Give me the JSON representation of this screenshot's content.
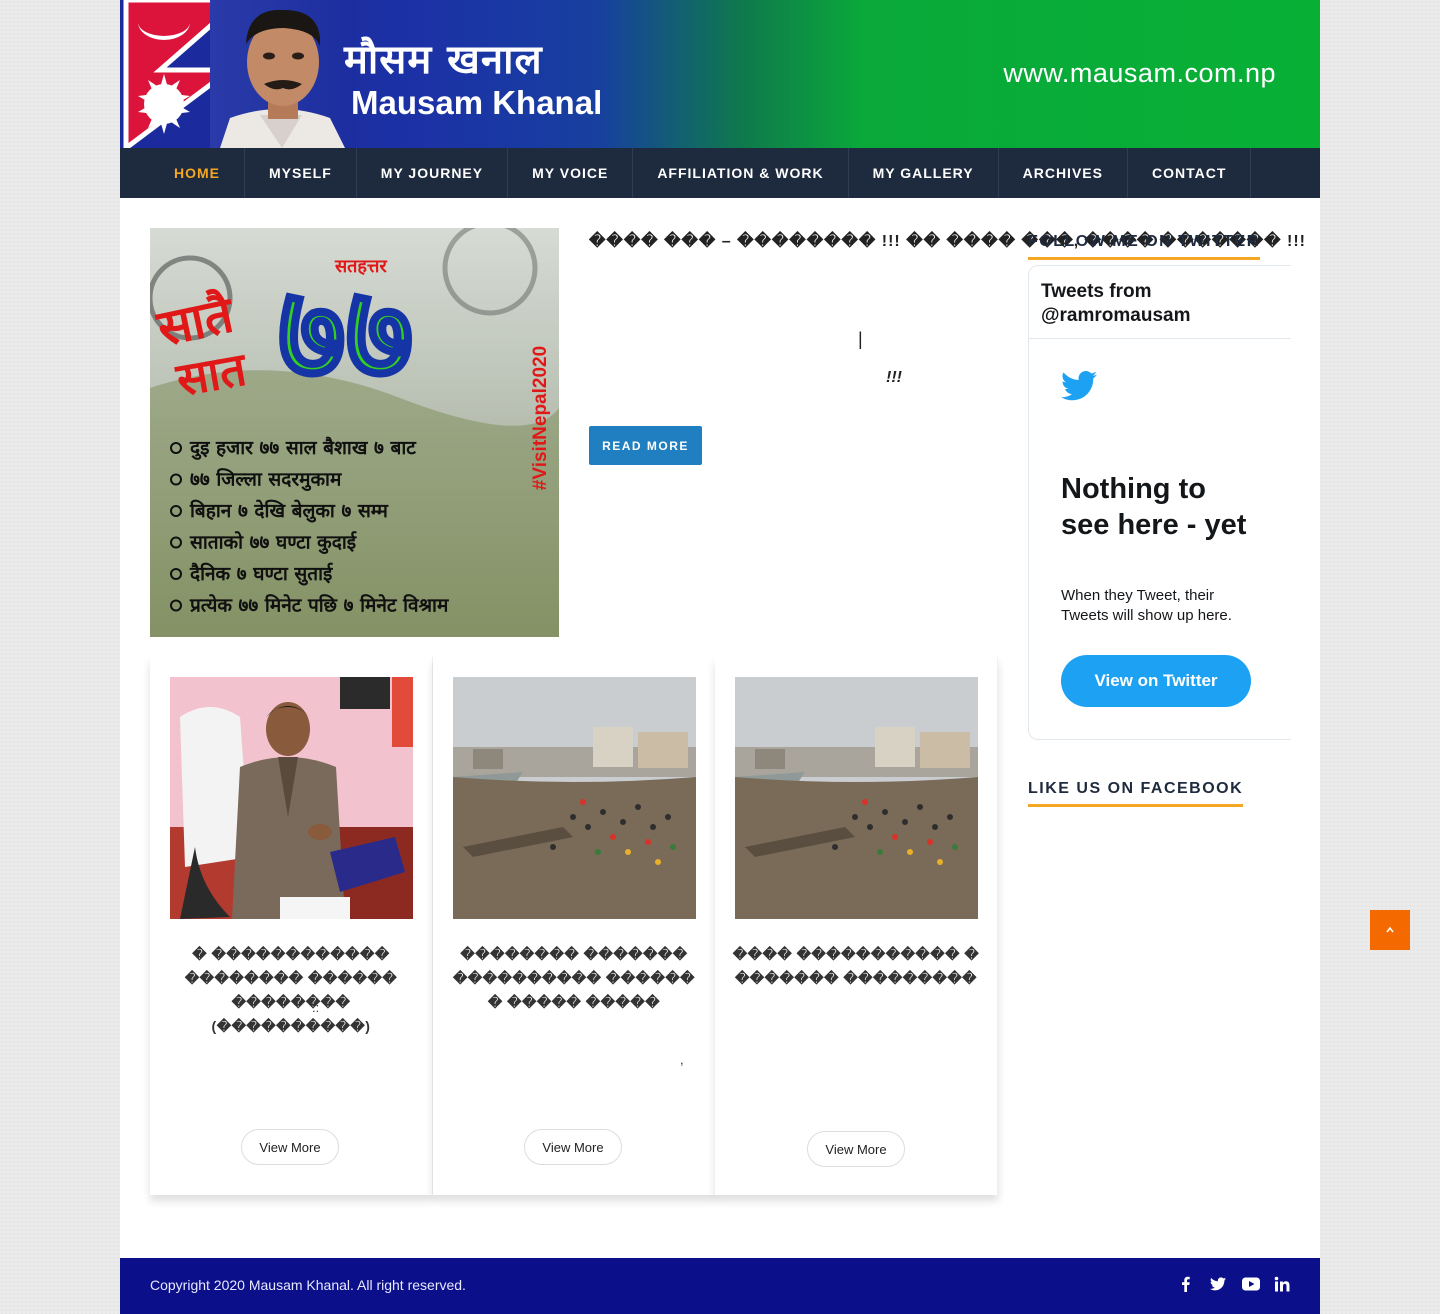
{
  "header": {
    "title_nepali": "मौसम खनाल",
    "title_english": "Mausam Khanal",
    "site_url": "www.mausam.com.np"
  },
  "nav": {
    "items": [
      {
        "label": "HOME",
        "active": true
      },
      {
        "label": "MYSELF"
      },
      {
        "label": "MY JOURNEY"
      },
      {
        "label": "MY VOICE"
      },
      {
        "label": "AFFILIATION & WORK"
      },
      {
        "label": "MY GALLERY"
      },
      {
        "label": "ARCHIVES"
      },
      {
        "label": "CONTACT"
      }
    ]
  },
  "featured": {
    "title": "���� ��� – �������� !!! �� ���� ���, ���� ������� !!!",
    "glyph_bar": "|",
    "glyph_exclaim": "!!!",
    "read_more_label": "READ MORE",
    "poster": {
      "heading_left_1": "सातै",
      "heading_left_2": "सात",
      "heading_small": "सतहत्तर",
      "big_number": "७७",
      "hashtag": "#VisitNepal2020",
      "lines": [
        "दुइ हजार ७७ साल बैशाख ७ बाट",
        "७७ जिल्ला सदरमुकाम",
        "बिहान ७ देखि बेलुका ७ सम्म",
        "साताको ७७ घण्टा कुदाई",
        "दैनिक ७ घण्टा सुताई",
        "प्रत्येक ७७ मिनेट पछि ७ मिनेट विश्राम"
      ]
    }
  },
  "cards": [
    {
      "title": "� ������������ �������� ������ �������� (����������)",
      "mark": "::",
      "button": "View More"
    },
    {
      "title": "�������� ������� ���������� ������ � ����� �����",
      "mark": ",",
      "button": "View More"
    },
    {
      "title": "���� ����������� � ������� ���������",
      "mark": "",
      "button": "View More"
    }
  ],
  "sidebar": {
    "twitter_title": "FOLLOW ME ON TWITTER",
    "twitter_header": "Tweets from @ramromausam",
    "twitter_empty_title": "Nothing to see here - yet",
    "twitter_empty_sub": "When they Tweet, their Tweets will show up here.",
    "twitter_button": "View on Twitter",
    "facebook_title": "LIKE US ON FACEBOOK"
  },
  "footer": {
    "copyright": "Copyright 2020 Mausam Khanal. All right reserved.",
    "social_icons": [
      "facebook-icon",
      "twitter-icon",
      "youtube-icon",
      "linkedin-icon"
    ]
  },
  "colors": {
    "nav_bg": "#1e2a3e",
    "nav_active": "#f5a623",
    "accent_blue": "#1f7fc0",
    "footer_bg": "#0b0f8a",
    "twitter_blue": "#1da1f2",
    "back_to_top": "#f56a00"
  }
}
